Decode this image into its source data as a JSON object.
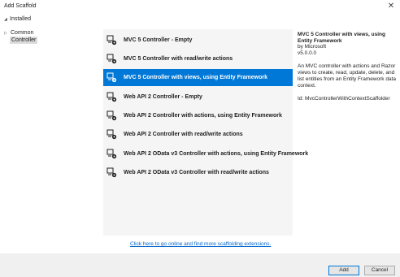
{
  "window": {
    "title": "Add Scaffold",
    "close_glyph": "✕"
  },
  "tree": {
    "root_label": "Installed",
    "items": [
      {
        "label": "Common"
      },
      {
        "label": "Controller"
      }
    ]
  },
  "scaffolds": [
    {
      "label": "MVC 5 Controller - Empty",
      "icon": "controller-icon"
    },
    {
      "label": "MVC 5 Controller with read/write actions",
      "icon": "controller-icon"
    },
    {
      "label": "MVC 5 Controller with views, using Entity Framework",
      "icon": "controller-icon",
      "selected": true
    },
    {
      "label": "Web API 2 Controller - Empty",
      "icon": "controller-icon"
    },
    {
      "label": "Web API 2 Controller with actions, using Entity Framework",
      "icon": "controller-icon"
    },
    {
      "label": "Web API 2 Controller with read/write actions",
      "icon": "controller-icon"
    },
    {
      "label": "Web API 2 OData v3 Controller with actions, using Entity Framework",
      "icon": "controller-icon"
    },
    {
      "label": "Web API 2 OData v3 Controller with read/write actions",
      "icon": "controller-icon"
    }
  ],
  "details": {
    "name": "MVC 5 Controller with views, using Entity Framework",
    "author": "by Microsoft",
    "version": "v5.0.0.0",
    "description": "An MVC controller with actions and Razor views to create, read, update, delete, and list entities from an Entity Framework data context.",
    "id": "Id: MvcControllerWithContextScaffolder"
  },
  "online_link": "Click here to go online and find more scaffolding extensions.",
  "buttons": {
    "add": "Add",
    "cancel": "Cancel"
  },
  "colors": {
    "selection": "#0078d7",
    "link": "#0066cc",
    "list_bg": "#f5f5f5"
  }
}
